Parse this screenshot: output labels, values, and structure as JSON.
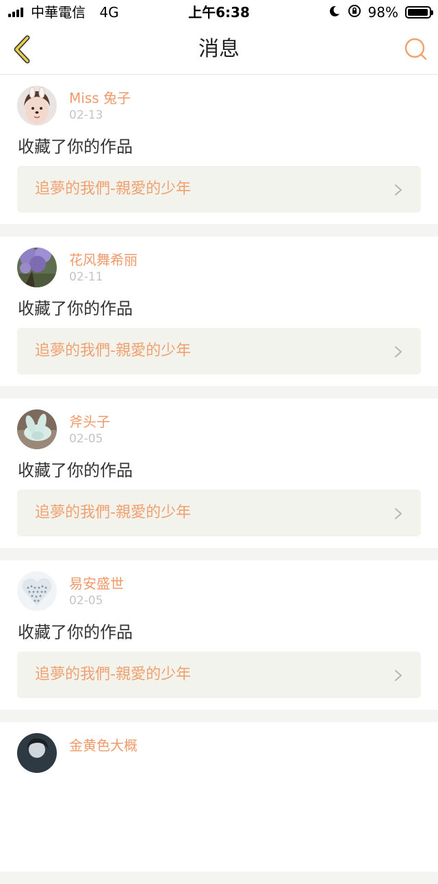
{
  "status_bar": {
    "carrier": "中華電信",
    "network": "4G",
    "time": "上午6:38",
    "battery": "98%",
    "battery_level": 0.98
  },
  "nav": {
    "title": "消息",
    "back_icon": "chevron-left-icon",
    "search_icon": "search-icon"
  },
  "colors": {
    "accent": "#f09a6a",
    "back_icon": "#e0c23c",
    "card_link_bg": "#f3f3ed",
    "separator": "#f4f4f2"
  },
  "notifications": [
    {
      "user": "Miss 兔子",
      "date": "02-13",
      "action": "收藏了你的作品",
      "work_title": "追夢的我們-親愛的少年"
    },
    {
      "user": "花风舞希丽",
      "date": "02-11",
      "action": "收藏了你的作品",
      "work_title": "追夢的我們-親愛的少年"
    },
    {
      "user": "斧头子",
      "date": "02-05",
      "action": "收藏了你的作品",
      "work_title": "追夢的我們-親愛的少年"
    },
    {
      "user": "易安盛世",
      "date": "02-05",
      "action": "收藏了你的作品",
      "work_title": "追夢的我們-親愛的少年"
    },
    {
      "user": "金黄色大概",
      "date": "",
      "action": "",
      "work_title": ""
    }
  ]
}
